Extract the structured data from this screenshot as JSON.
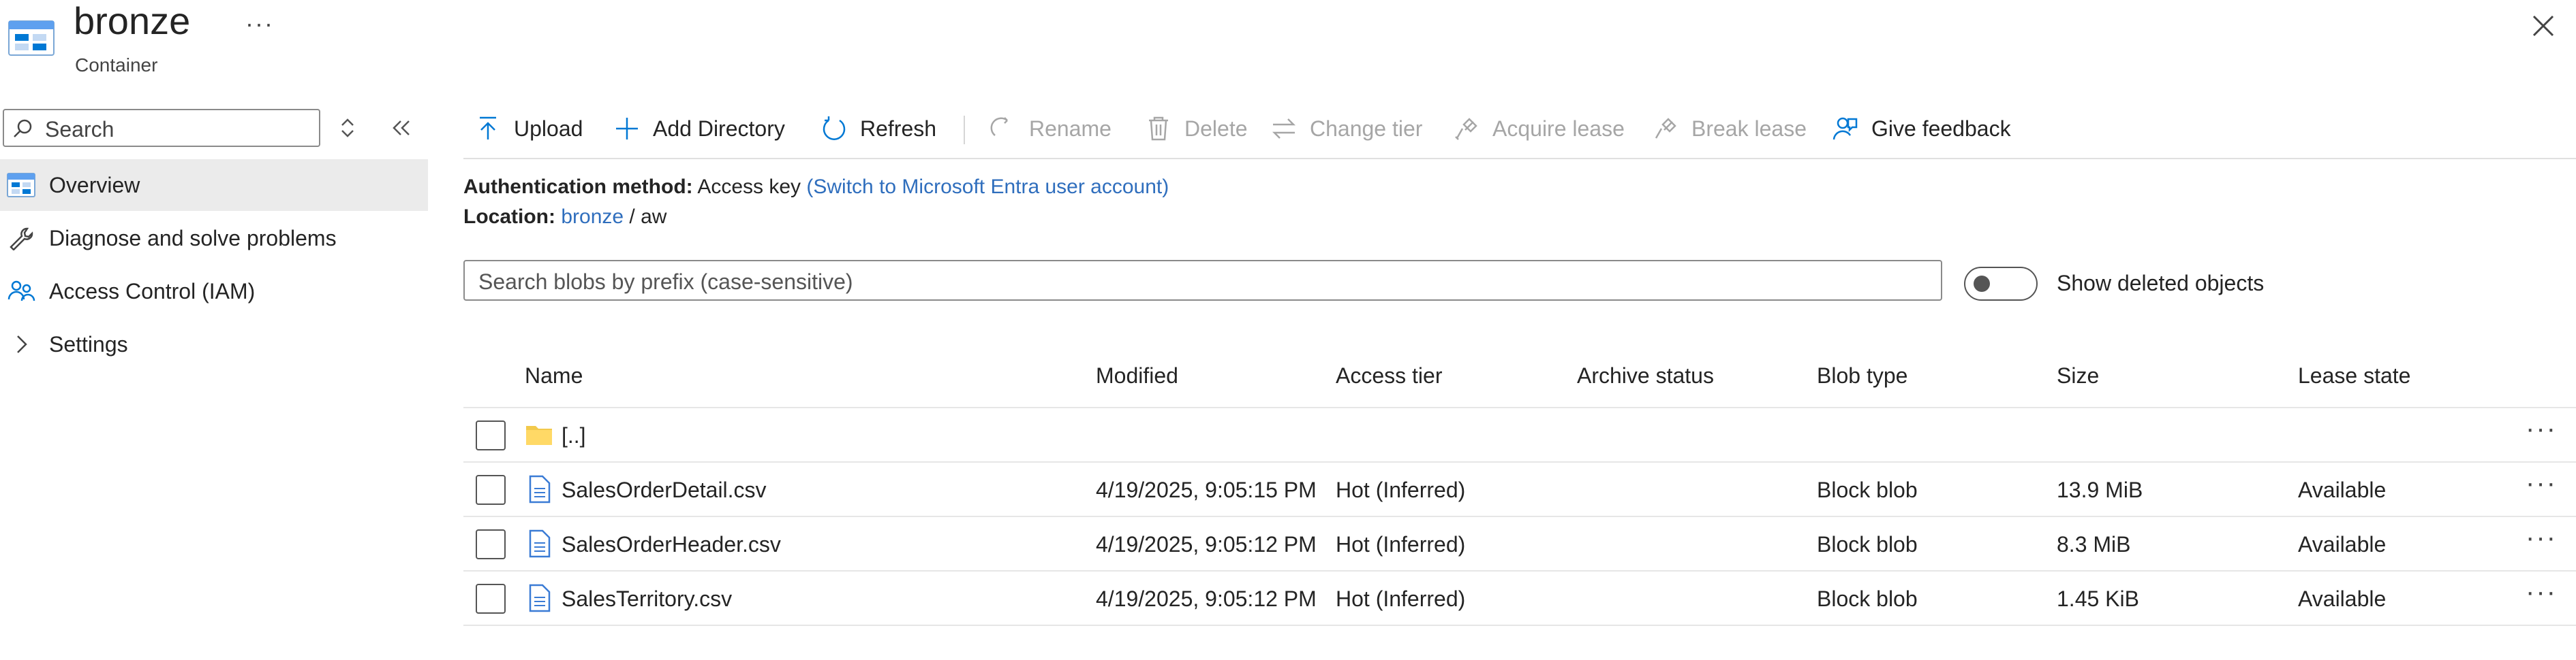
{
  "header": {
    "title": "bronze",
    "subtitle": "Container",
    "more": "···"
  },
  "sidebar": {
    "search_placeholder": "Search",
    "items": [
      {
        "label": "Overview",
        "icon": "container-icon",
        "active": true
      },
      {
        "label": "Diagnose and solve problems",
        "icon": "wrench-icon"
      },
      {
        "label": "Access Control (IAM)",
        "icon": "people-icon"
      },
      {
        "label": "Settings",
        "icon": "chevron-right-icon"
      }
    ]
  },
  "toolbar": {
    "upload": "Upload",
    "add_directory": "Add Directory",
    "refresh": "Refresh",
    "rename": "Rename",
    "delete": "Delete",
    "change_tier": "Change tier",
    "acquire_lease": "Acquire lease",
    "break_lease": "Break lease",
    "give_feedback": "Give feedback"
  },
  "auth": {
    "label": "Authentication method:",
    "value": "Access key",
    "switch_link": "(Switch to Microsoft Entra user account)"
  },
  "location": {
    "label": "Location:",
    "container": "bronze",
    "sep": "/",
    "folder": "aw"
  },
  "blob_search": {
    "placeholder": "Search blobs by prefix (case-sensitive)"
  },
  "show_deleted": {
    "label": "Show deleted objects",
    "on": false
  },
  "table": {
    "columns": [
      "Name",
      "Modified",
      "Access tier",
      "Archive status",
      "Blob type",
      "Size",
      "Lease state"
    ],
    "rows": [
      {
        "name": "[..]",
        "type": "folder",
        "modified": "",
        "tier": "",
        "archive": "",
        "blob_type": "",
        "size": "",
        "lease": ""
      },
      {
        "name": "SalesOrderDetail.csv",
        "type": "file",
        "modified": "4/19/2025, 9:05:15 PM",
        "tier": "Hot (Inferred)",
        "archive": "",
        "blob_type": "Block blob",
        "size": "13.9 MiB",
        "lease": "Available"
      },
      {
        "name": "SalesOrderHeader.csv",
        "type": "file",
        "modified": "4/19/2025, 9:05:12 PM",
        "tier": "Hot (Inferred)",
        "archive": "",
        "blob_type": "Block blob",
        "size": "8.3 MiB",
        "lease": "Available"
      },
      {
        "name": "SalesTerritory.csv",
        "type": "file",
        "modified": "4/19/2025, 9:05:12 PM",
        "tier": "Hot (Inferred)",
        "archive": "",
        "blob_type": "Block blob",
        "size": "1.45 KiB",
        "lease": "Available"
      }
    ],
    "row_more": "···"
  },
  "colors": {
    "accent": "#2f6ebd",
    "icon_blue": "#0078d4",
    "folder": "#f2c94c",
    "disabled": "#a6a6a6"
  }
}
